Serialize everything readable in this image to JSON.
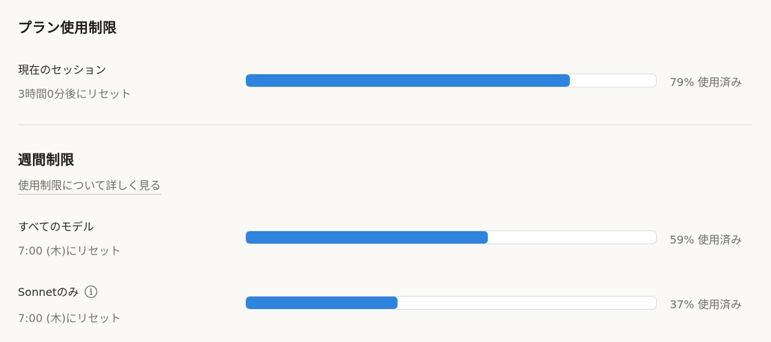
{
  "plan": {
    "title": "プラン使用制限",
    "session": {
      "label": "現在のセッション",
      "reset": "3時間0分後にリセット",
      "percent": 79,
      "used_text": "79% 使用済み"
    }
  },
  "weekly": {
    "title": "週間制限",
    "learn_more": "使用制限について詳しく見る",
    "all_models": {
      "label": "すべてのモデル",
      "reset": "7:00 (木)にリセット",
      "percent": 59,
      "used_text": "59% 使用済み"
    },
    "sonnet": {
      "label": "Sonnetのみ",
      "icon": "info-icon",
      "reset": "7:00 (木)にリセット",
      "percent": 37,
      "used_text": "37% 使用済み"
    }
  },
  "colors": {
    "accent": "#2e84dc",
    "background": "#faf9f6"
  }
}
